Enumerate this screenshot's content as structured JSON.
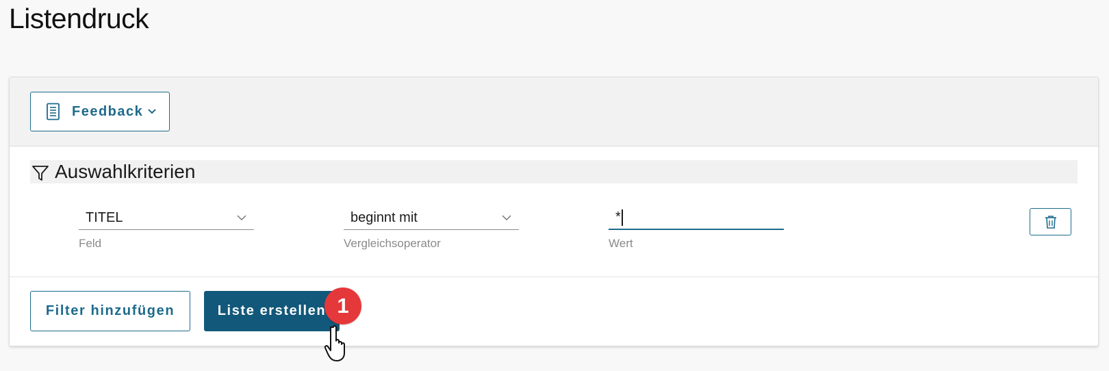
{
  "page": {
    "title": "Listendruck"
  },
  "toolbar": {
    "feedback_label": "Feedback",
    "feedback_icon": "document-list-icon",
    "feedback_dropdown_icon": "chevron-down-icon"
  },
  "criteria": {
    "title": "Auswahlkriterien",
    "icon": "filter-icon",
    "row": {
      "field": {
        "value": "TITEL",
        "label": "Feld"
      },
      "operator": {
        "value": "beginnt mit",
        "label": "Vergleichsoperator"
      },
      "value": {
        "value": "*",
        "label": "Wert"
      },
      "delete_icon": "trash-icon"
    }
  },
  "actions": {
    "add_filter_label": "Filter hinzufügen",
    "create_list_label": "Liste erstellen"
  },
  "annotation": {
    "step_number": "1",
    "cursor": "hand-pointer-icon"
  },
  "colors": {
    "accent": "#1d6a8b",
    "primary_button": "#12587a",
    "badge": "#e5383b"
  }
}
